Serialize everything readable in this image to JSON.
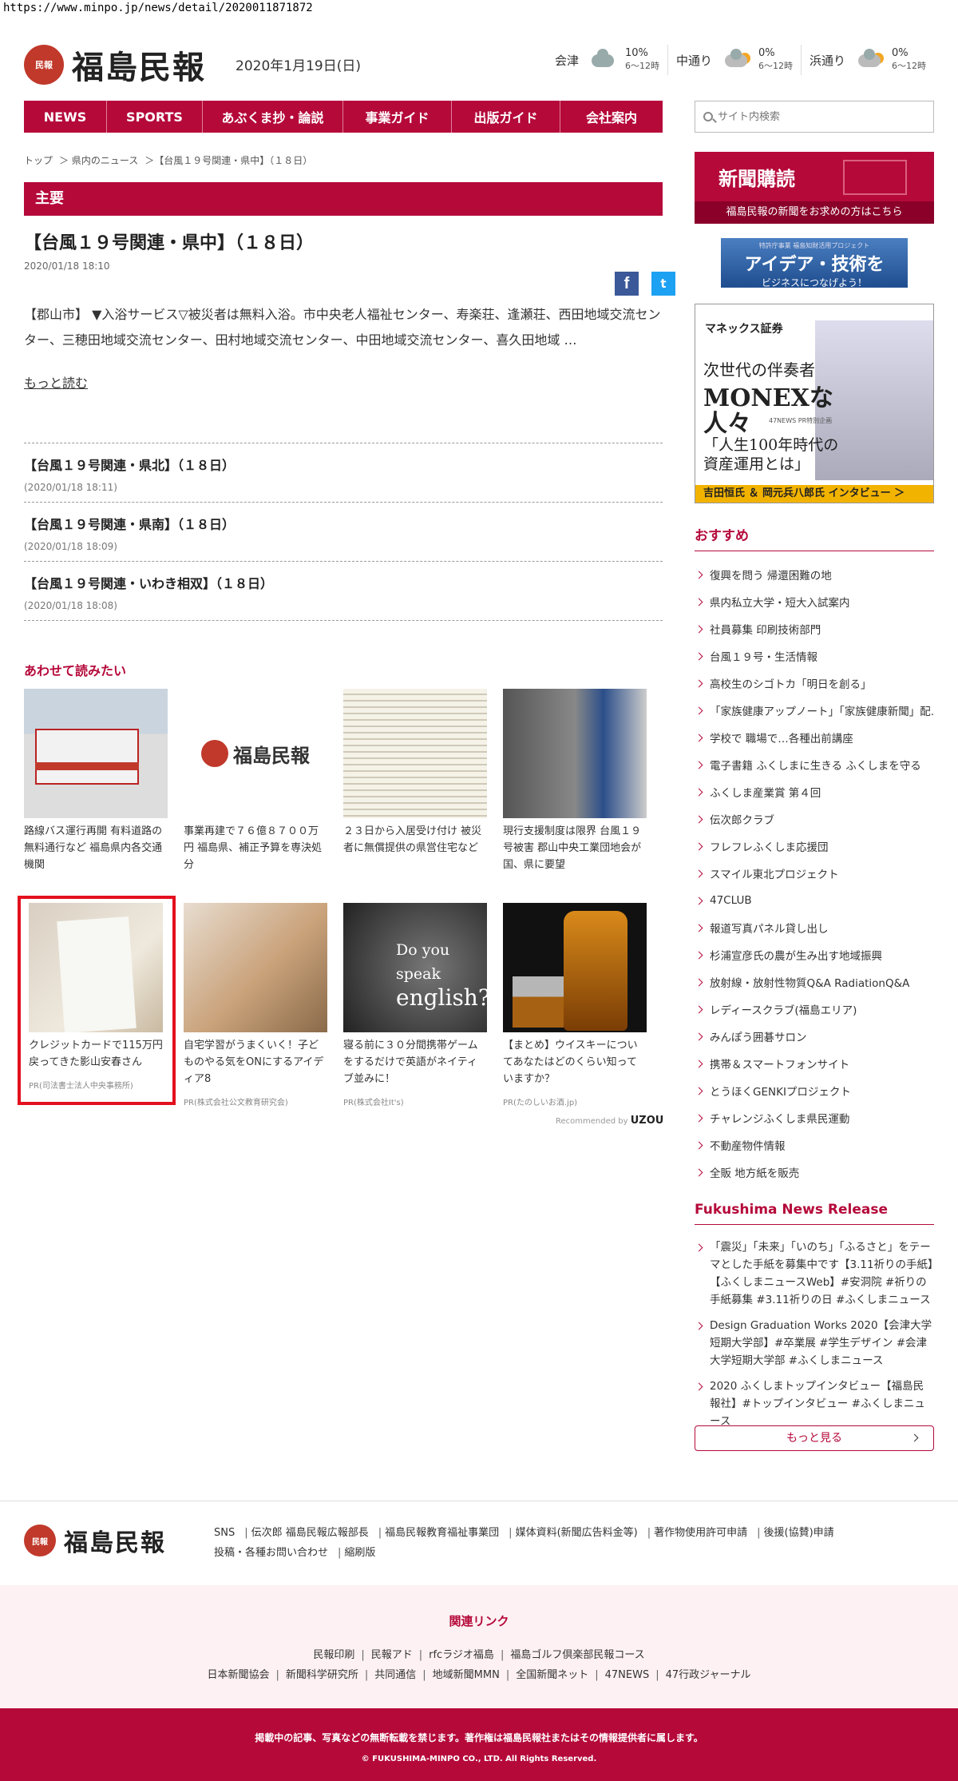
{
  "browser": {
    "url": "https://www.minpo.jp/news/detail/2020011871872"
  },
  "header": {
    "logo_mark": "民報",
    "logo_text": "福島民報",
    "date": "2020年1月19日(日)",
    "weather": [
      {
        "area": "会津",
        "value": "10%",
        "sub": "6〜12時",
        "icon": "cloud-icon"
      },
      {
        "area": "中通り",
        "value": "0%",
        "sub": "6〜12時",
        "icon": "cloud-sun-icon"
      },
      {
        "area": "浜通り",
        "value": "0%",
        "sub": "6〜12時",
        "icon": "cloud-sun-icon"
      }
    ]
  },
  "nav": {
    "items": [
      "NEWS",
      "SPORTS",
      "あぶくま抄・論説",
      "事業ガイド",
      "出版ガイド",
      "会社案内"
    ]
  },
  "search": {
    "placeholder": "サイト内検索"
  },
  "breadcrumb": [
    "トップ",
    "＞ 県内のニュース",
    "＞【台風１９号関連・県中】（１８日）"
  ],
  "article": {
    "section": "主要",
    "title": "【台風１９号関連・県中】（１８日）",
    "date": "2020/01/18 18:10",
    "body": "【郡山市】 ▼入浴サービス▽被災者は無料入浴。市中央老人福祉センター、寿楽荘、逢瀬荘、西田地域交流センター、三穂田地域交流センター、田村地域交流センター、中田地域交流センター、喜久田地域 …",
    "read_more": "もっと読む",
    "share": {
      "facebook": "f",
      "twitter": "t"
    }
  },
  "related": [
    {
      "title": "【台風１９号関連・県北】（１８日）",
      "date": "(2020/01/18 18:11)"
    },
    {
      "title": "【台風１９号関連・県南】（１８日）",
      "date": "(2020/01/18 18:09)"
    },
    {
      "title": "【台風１９号関連・いわき相双】（１８日）",
      "date": "(2020/01/18 18:08)"
    }
  ],
  "also_read": {
    "heading": "あわせて読みたい",
    "cards": [
      {
        "caption": "路線バス運行再開 有料道路の無料通行など 福島県内各交通機関",
        "pr": ""
      },
      {
        "caption": "事業再建で７６億８７００万円 福島県、補正予算を専決処分",
        "pr": ""
      },
      {
        "caption": "２３日から入居受け付け 被災者に無償提供の県営住宅など",
        "pr": ""
      },
      {
        "caption": "現行支援制度は限界 台風１９号被害 郡山中央工業団地会が国、県に要望",
        "pr": ""
      },
      {
        "caption": "クレジットカードで115万円戻ってきた影山安春さん",
        "pr": "PR(司法書士法人中央事務所)"
      },
      {
        "caption": "自宅学習がうまくいく！子どものやる気をONにするアイディア8",
        "pr": "PR(株式会社公文教育研究会)"
      },
      {
        "caption": "寝る前に３０分間携帯ゲームをするだけで英語がネイティブ並みに！",
        "pr": "PR(株式会社It's)"
      },
      {
        "caption": "【まとめ】ウイスキーについてあなたはどのくらい知っていますか？",
        "pr": "PR(たのしいお酒.jp)"
      }
    ],
    "thumb_logo_text": "福島民報",
    "thumb_eng_text_1": "Do you speak",
    "thumb_eng_text_2": "english?",
    "recommended_by": "Recommended by",
    "recommended_brand": "UZOU"
  },
  "sidebar": {
    "subscribe_title": "新聞購読",
    "subscribe_sub": "福島民報の新聞をお求めの方はこちら",
    "idea_top": "特許庁事業 福島知財活用プロジェクト",
    "idea_main": "アイデア・技術を",
    "idea_sub": "ビジネスにつなげよう！",
    "monex_logo": "マネックス証券",
    "monex_l1": "次世代の伴奏者",
    "monex_l2": "MONEXな",
    "monex_l3": "人々",
    "monex_pr": "47NEWS PR特別企画",
    "monex_q1": "「人生100年時代の",
    "monex_q2": "資産運用とは」",
    "monex_bar": "吉田恒氏 ＆ 岡元兵八郎氏 インタビュー ＞",
    "reco_heading": "おすすめ",
    "reco_items": [
      "復興を問う 帰還困難の地",
      "県内私立大学・短大入試案内",
      "社員募集 印刷技術部門",
      "台風１９号・生活情報",
      "高校生のシゴトカ「明日を創る」",
      "「家族健康アップノート」「家族健康新聞」配…",
      "学校で 職場で…各種出前講座",
      "電子書籍 ふくしまに生きる ふくしまを守る",
      "ふくしま産業賞 第４回",
      "伝次郎クラブ",
      "フレフレふくしま応援団",
      "スマイル東北プロジェクト",
      "47CLUB",
      "報道写真パネル貸し出し",
      "杉浦宣彦氏の農が生み出す地域振興",
      "放射線・放射性物質Q&A RadiationQ&A",
      "レディースクラブ(福島エリア)",
      "みんぽう囲碁サロン",
      "携帯＆スマートフォンサイト",
      "とうほくGENKIプロジェクト",
      "チャレンジふくしま県民運動",
      "不動産物件情報",
      "全販 地方紙を販売"
    ],
    "news_heading": "Fukushima News Release",
    "news_items": [
      "「震災」「未来」「いのち」「ふるさと」をテーマとした手紙を募集中です【3.11祈りの手紙】【ふくしまニュースWeb】#安洞院 #祈りの手紙募集 #3.11祈りの日 #ふくしまニュース",
      "Design Graduation Works 2020【会津大学短期大学部】#卒業展 #学生デザイン #会津大学短期大学部 #ふくしまニュース",
      "2020 ふくしまトップインタビュー【福島民報社】#トップインタビュー #ふくしまニュース"
    ],
    "more_label": "もっと見る"
  },
  "footer": {
    "links_row1": [
      "SNS",
      "伝次郎 福島民報広報部長",
      "福島民報教育福祉事業団",
      "媒体資料(新聞広告料金等)",
      "著作物使用許可申請",
      "後援(協賛)申請"
    ],
    "links_row2": [
      "投稿・各種お問い合わせ",
      "縮刷版"
    ],
    "related_title": "関連リンク",
    "related_row1": [
      "民報印刷",
      "民報アド",
      "rfcラジオ福島",
      "福島ゴルフ倶楽部民報コース"
    ],
    "related_row2": [
      "日本新聞協会",
      "新聞科学研究所",
      "共同通信",
      "地域新聞MMN",
      "全国新聞ネット",
      "47NEWS",
      "47行政ジャーナル"
    ],
    "copy1": "掲載中の記事、写真などの無断転載を禁じます。著作権は福島民報社またはその情報提供者に属します。",
    "copy2": "© FUKUSHIMA-MINPO CO., LTD. All Rights Reserved."
  },
  "colors": {
    "brand": "#b5093a",
    "highlight": "#e3101e"
  }
}
